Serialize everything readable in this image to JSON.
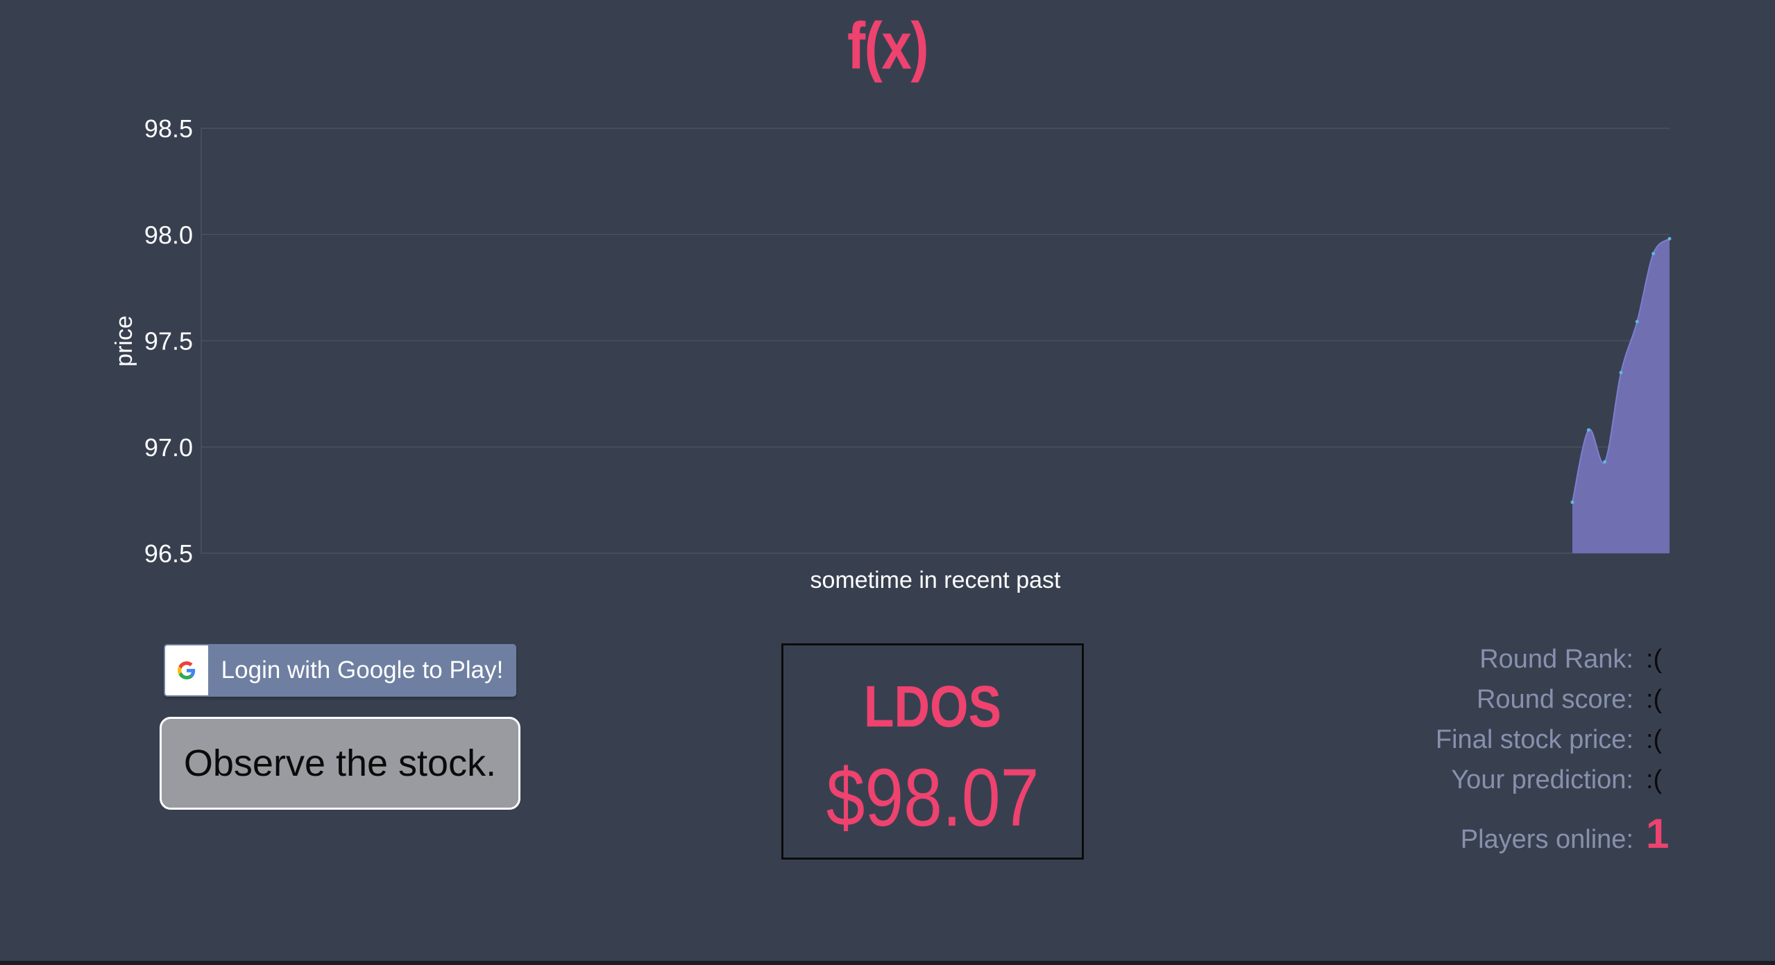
{
  "app": {
    "title": "f(x)"
  },
  "chart_data": {
    "type": "area",
    "ylabel": "price",
    "xlabel": "sometime in recent past",
    "ylim": [
      96.5,
      98.5
    ],
    "yticks": [
      "98.5",
      "98.0",
      "97.5",
      "97.0",
      "96.5"
    ],
    "grid": true,
    "series": [
      {
        "values": [
          96.74,
          97.08,
          96.93,
          97.35,
          97.59,
          97.91,
          97.98
        ],
        "color": "#6f6fb2"
      }
    ]
  },
  "login": {
    "google_label": "Login with Google to Play!",
    "google_icon": "google-g-icon"
  },
  "observe": {
    "label": "Observe the stock."
  },
  "quote": {
    "ticker": "LDOS",
    "price": "$98.07"
  },
  "stats": {
    "round_rank_label": "Round Rank:",
    "round_rank_value": ":(",
    "round_score_label": "Round score:",
    "round_score_value": ":(",
    "final_price_label": "Final stock price:",
    "final_price_value": ":(",
    "prediction_label": "Your prediction:",
    "prediction_value": ":(",
    "players_label": "Players online:",
    "players_value": "1"
  },
  "colors": {
    "background": "#384050",
    "accent": "#ee426f",
    "area_fill": "#6f6fb2",
    "muted_text": "#8791ad"
  }
}
